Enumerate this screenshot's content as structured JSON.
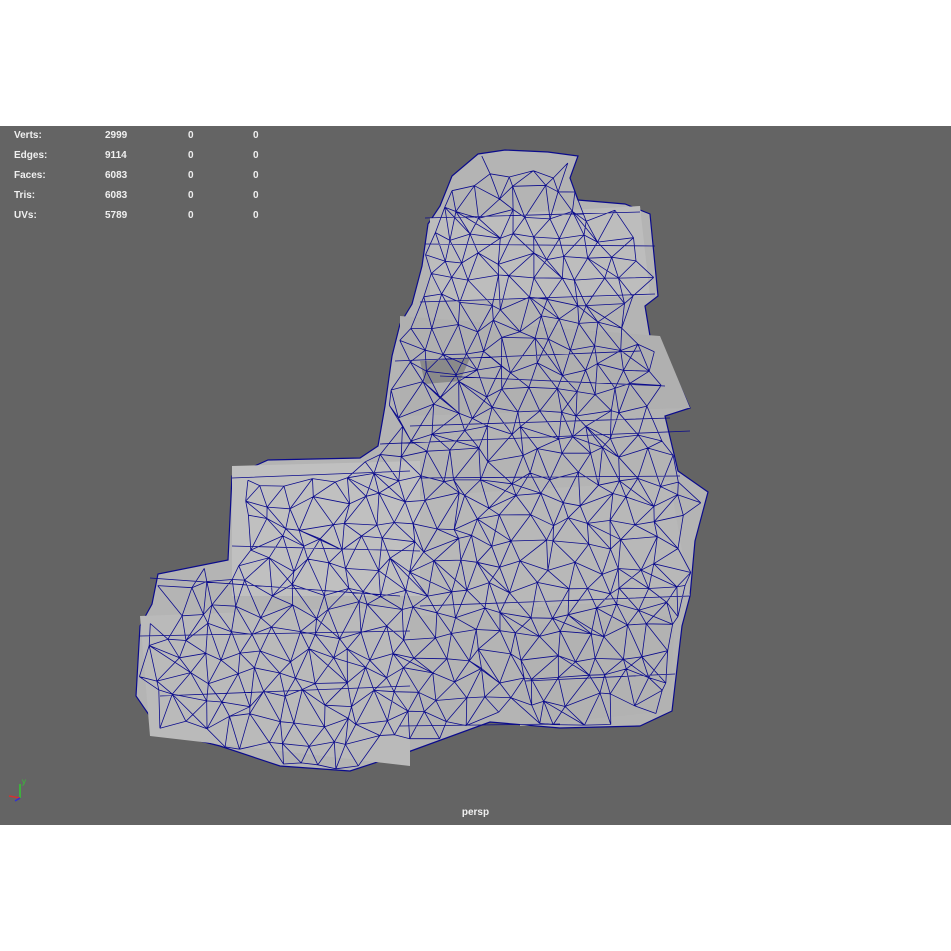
{
  "viewport": {
    "camera": "persp",
    "background": "#646464",
    "wire_color": "#0b0b8c",
    "surface_color": "#b4b4b4"
  },
  "hud": {
    "rows": [
      {
        "label": "Verts:",
        "v1": "2999",
        "v2": "0",
        "v3": "0"
      },
      {
        "label": "Edges:",
        "v1": "9114",
        "v2": "0",
        "v3": "0"
      },
      {
        "label": "Faces:",
        "v1": "6083",
        "v2": "0",
        "v3": "0"
      },
      {
        "label": "Tris:",
        "v1": "6083",
        "v2": "0",
        "v3": "0"
      },
      {
        "label": "UVs:",
        "v1": "5789",
        "v2": "0",
        "v3": "0"
      }
    ]
  },
  "axis_gizmo": {
    "y_label": "y",
    "x_color": "#d23232",
    "y_color": "#32c832",
    "z_color": "#3232d2"
  }
}
